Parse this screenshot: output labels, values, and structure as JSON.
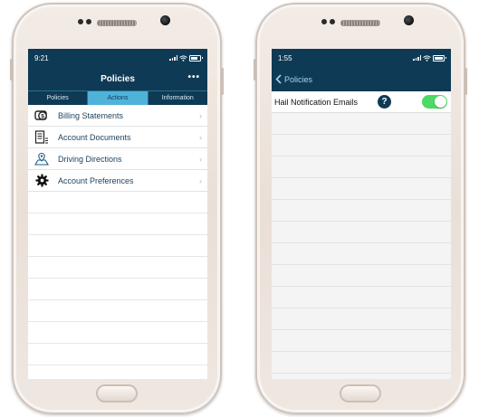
{
  "left_screen": {
    "status": {
      "time": "9:21"
    },
    "header": {
      "title": "Policies",
      "more_label": "•••"
    },
    "tabs": [
      {
        "label": "Policies",
        "active": false
      },
      {
        "label": "Actions",
        "active": true
      },
      {
        "label": "Information",
        "active": false
      }
    ],
    "menu": [
      {
        "label": "Billing Statements",
        "icon": "billing-icon"
      },
      {
        "label": "Account Documents",
        "icon": "documents-icon"
      },
      {
        "label": "Driving Directions",
        "icon": "map-pin-icon"
      },
      {
        "label": "Account Preferences",
        "icon": "gear-icon"
      }
    ],
    "chevron": "›"
  },
  "right_screen": {
    "status": {
      "time": "1:55"
    },
    "nav": {
      "back_label": "Policies"
    },
    "setting": {
      "label": "Hail Notification Emails",
      "help": "?",
      "enabled": true
    }
  },
  "colors": {
    "header": "#0f3a55",
    "tab_active": "#4fb3d9",
    "toggle_on": "#4cd964"
  }
}
